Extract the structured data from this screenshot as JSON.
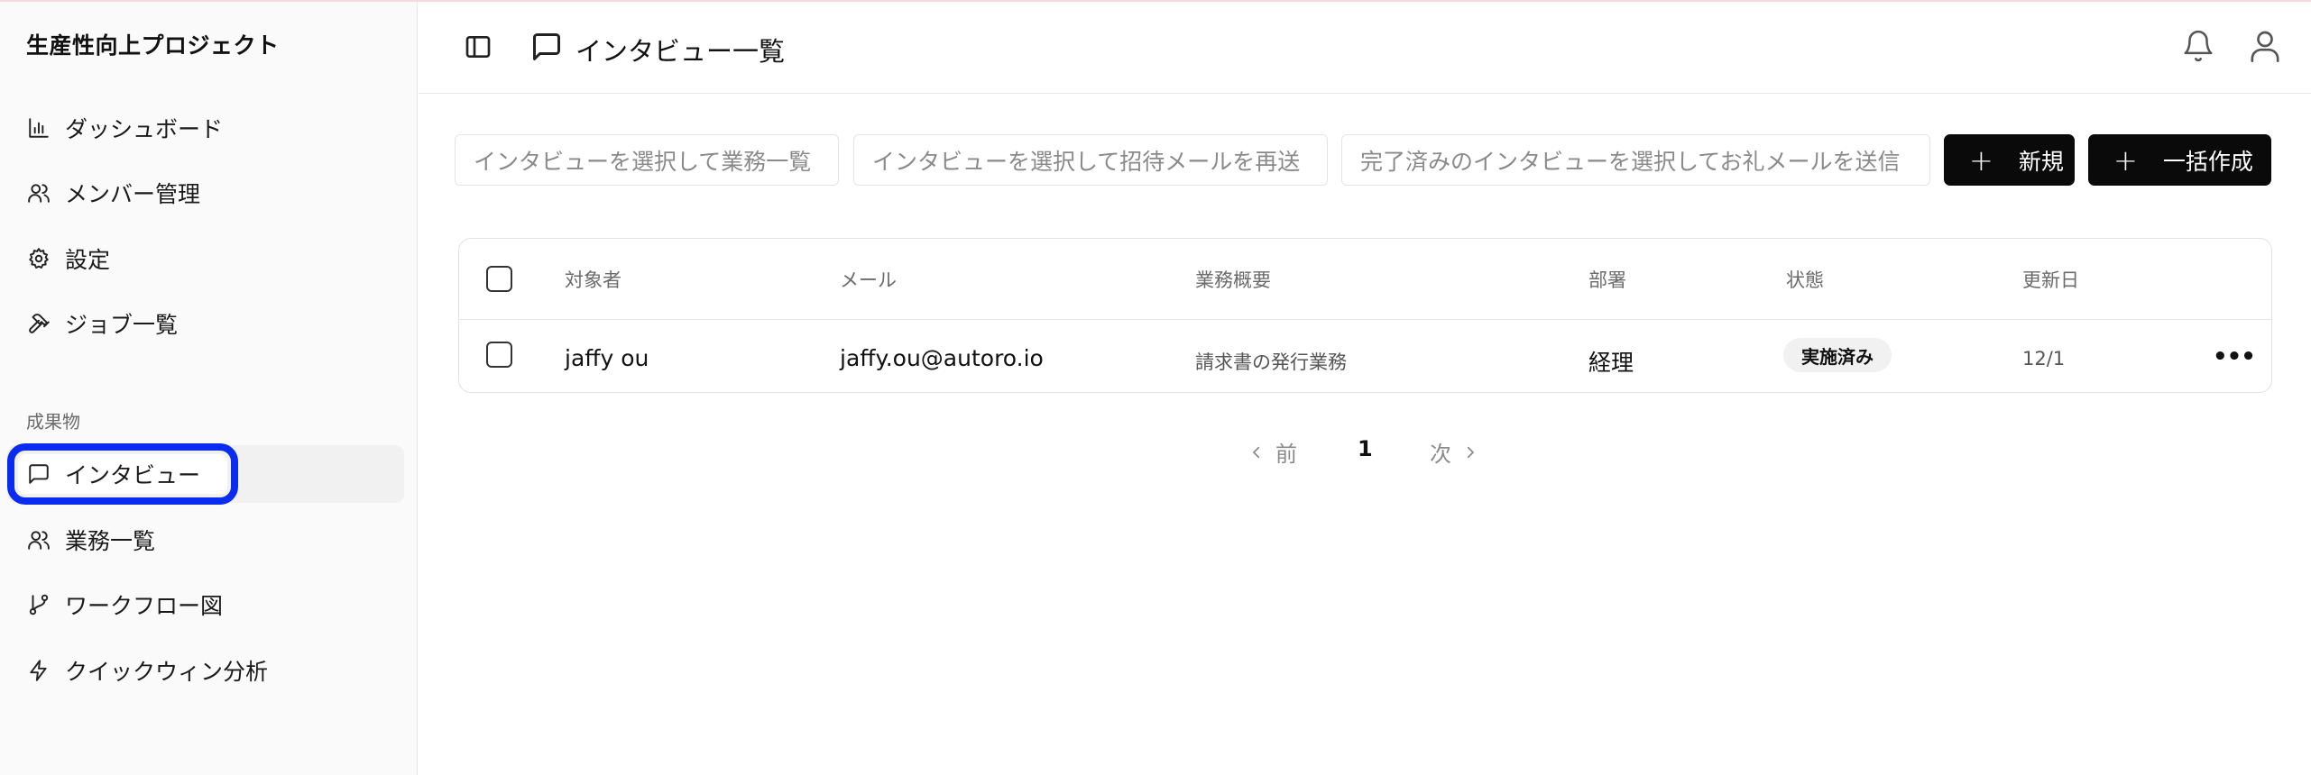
{
  "sidebar": {
    "project_title": "生産性向上プロジェクト",
    "nav": [
      {
        "label": "ダッシュボード",
        "icon": "bar-chart-icon"
      },
      {
        "label": "メンバー管理",
        "icon": "users-icon"
      },
      {
        "label": "設定",
        "icon": "gear-icon"
      },
      {
        "label": "ジョブ一覧",
        "icon": "hammer-icon"
      }
    ],
    "section_label": "成果物",
    "deliverables": [
      {
        "label": "インタビュー",
        "icon": "message-square-icon",
        "active": true
      },
      {
        "label": "業務一覧",
        "icon": "users-icon"
      },
      {
        "label": "ワークフロー図",
        "icon": "git-branch-icon"
      },
      {
        "label": "クイックウィン分析",
        "icon": "zap-icon"
      }
    ]
  },
  "header": {
    "title": "インタビュー一覧"
  },
  "toolbar": {
    "action1": "インタビューを選択して業務一覧",
    "action2": "インタビューを選択して招待メールを再送",
    "action3": "完了済みのインタビューを選択してお礼メールを送信",
    "new_button": "新規",
    "bulk_button": "一括作成"
  },
  "table": {
    "columns": [
      "対象者",
      "メール",
      "業務概要",
      "部署",
      "状態",
      "更新日"
    ],
    "rows": [
      {
        "target": "jaffy ou",
        "email": "jaffy.ou@autoro.io",
        "summary": "請求書の発行業務",
        "dept": "経理",
        "status": "実施済み",
        "updated": "12/1"
      }
    ]
  },
  "pagination": {
    "prev": "前",
    "current": "1",
    "next": "次"
  },
  "colors": {
    "highlight": "#0a2cf0",
    "button_bg": "#0a0a0a"
  }
}
